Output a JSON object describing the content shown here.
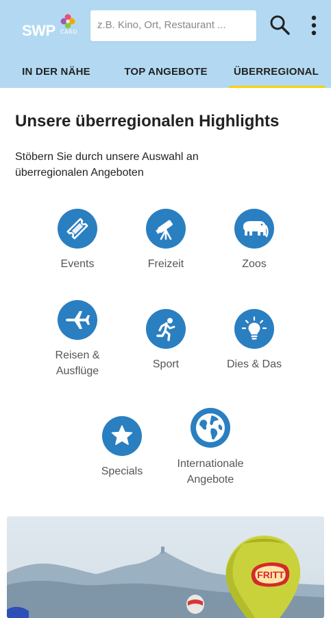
{
  "header": {
    "logo_text": "SWP",
    "logo_card": "CARD",
    "search": {
      "placeholder": "z.B. Kino, Ort, Restaurant ..."
    },
    "icons": {
      "search": "search-icon",
      "more": "more-vert-icon"
    },
    "colors": {
      "background": "#b3d9f2",
      "tab_indicator": "#f7d100"
    }
  },
  "tabs": [
    {
      "label": "IN DER NÄHE",
      "active": false
    },
    {
      "label": "TOP ANGEBOTE",
      "active": false
    },
    {
      "label": "ÜBERREGIONAL",
      "active": true
    }
  ],
  "main": {
    "title": "Unsere überregionalen Highlights",
    "subtitle": "Stöbern Sie durch unsere Auswahl an überregionalen Angeboten",
    "icon_color": "#2a7fc1",
    "categories": [
      {
        "label": "Events",
        "icon": "ticket-icon"
      },
      {
        "label": "Freizeit",
        "icon": "telescope-icon"
      },
      {
        "label": "Zoos",
        "icon": "elephant-icon"
      },
      {
        "label": "Reisen & Ausflüge",
        "icon": "airplane-icon"
      },
      {
        "label": "Sport",
        "icon": "runner-icon"
      },
      {
        "label": "Dies & Das",
        "icon": "lightbulb-icon"
      },
      {
        "label": "Specials",
        "icon": "star-icon"
      },
      {
        "label": "Internationale Angebote",
        "icon": "globe-icon"
      }
    ]
  },
  "banner": {
    "balloon_text": "FRITT",
    "image": "hot-air-balloons-photo"
  }
}
